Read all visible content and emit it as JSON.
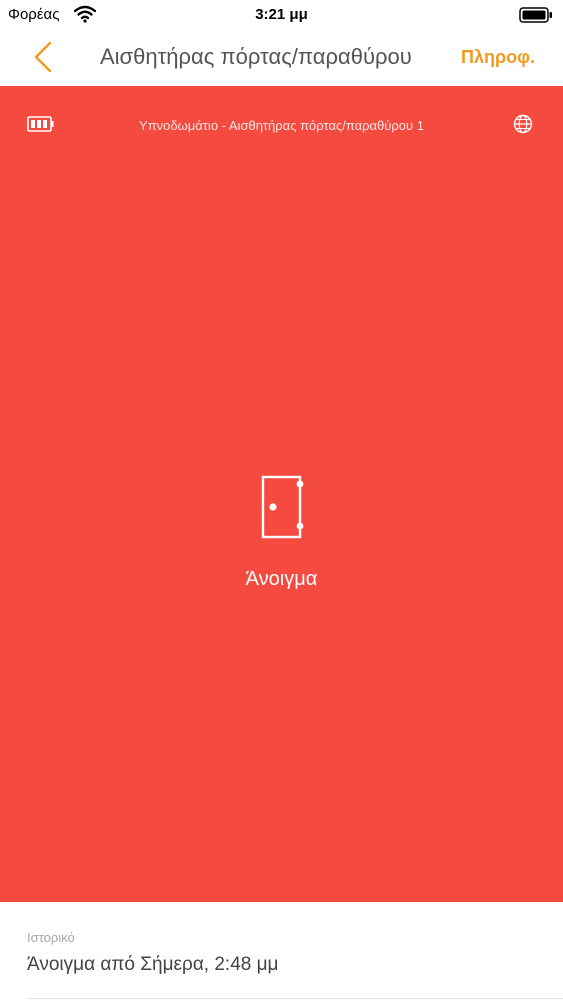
{
  "status_bar": {
    "carrier": "Φορέας",
    "time": "3:21 μμ"
  },
  "nav": {
    "title": "Αισθητήρας πόρτας/παραθύρου",
    "info": "Πληροφ."
  },
  "device": {
    "location_name": "Υπνοδωμάτιο - Αισθητήρας πόρτας/παραθύρου 1",
    "state": "Άνοιγμα"
  },
  "history": {
    "label": "Ιστορικό",
    "last_entry": "Άνοιγμα από Σήμερα, 2:48 μμ"
  },
  "colors": {
    "panel_red": "#f44a40",
    "accent_orange": "#f29a1f"
  },
  "icons": {
    "back": "chevron-left-icon",
    "battery": "battery-icon",
    "globe": "globe-icon",
    "door": "door-open-icon"
  }
}
